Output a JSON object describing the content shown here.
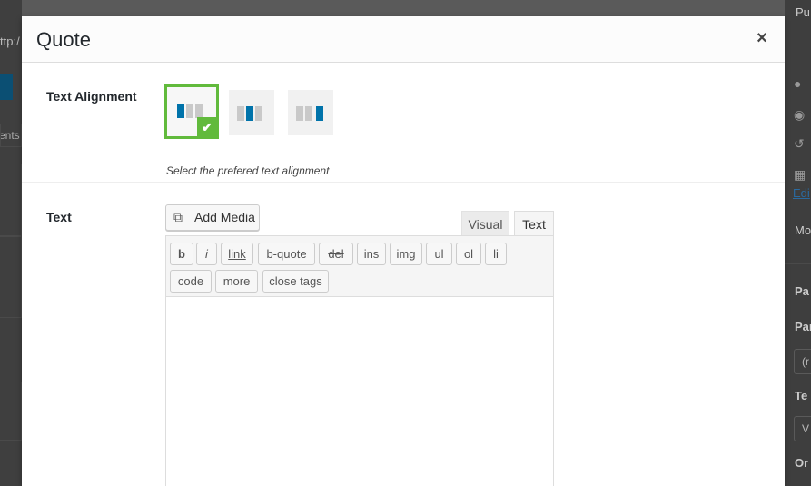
{
  "background": {
    "url_fragment": "ttp:/",
    "tab_fragment": "ments",
    "right_labels": [
      "Pu",
      "Edi",
      "Mo",
      "Pa",
      "Par",
      "(r",
      "Te",
      "V",
      "Or"
    ]
  },
  "modal": {
    "title": "Quote",
    "close_icon": "×"
  },
  "alignment": {
    "label": "Text Alignment",
    "help": "Select the prefered text alignment",
    "options": [
      "left",
      "center",
      "right"
    ],
    "selected": "left",
    "check": "✔"
  },
  "text_field": {
    "label": "Text",
    "add_media": "Add Media",
    "tabs": {
      "visual": "Visual",
      "text": "Text"
    },
    "active_tab": "Text",
    "quicktags": {
      "b": "b",
      "i": "i",
      "link": "link",
      "bquote": "b-quote",
      "del": "del",
      "ins": "ins",
      "img": "img",
      "ul": "ul",
      "ol": "ol",
      "li": "li",
      "code": "code",
      "more": "more",
      "close": "close tags"
    },
    "value": ""
  },
  "colors": {
    "accent_green": "#61ba3c",
    "accent_blue": "#0073aa"
  }
}
